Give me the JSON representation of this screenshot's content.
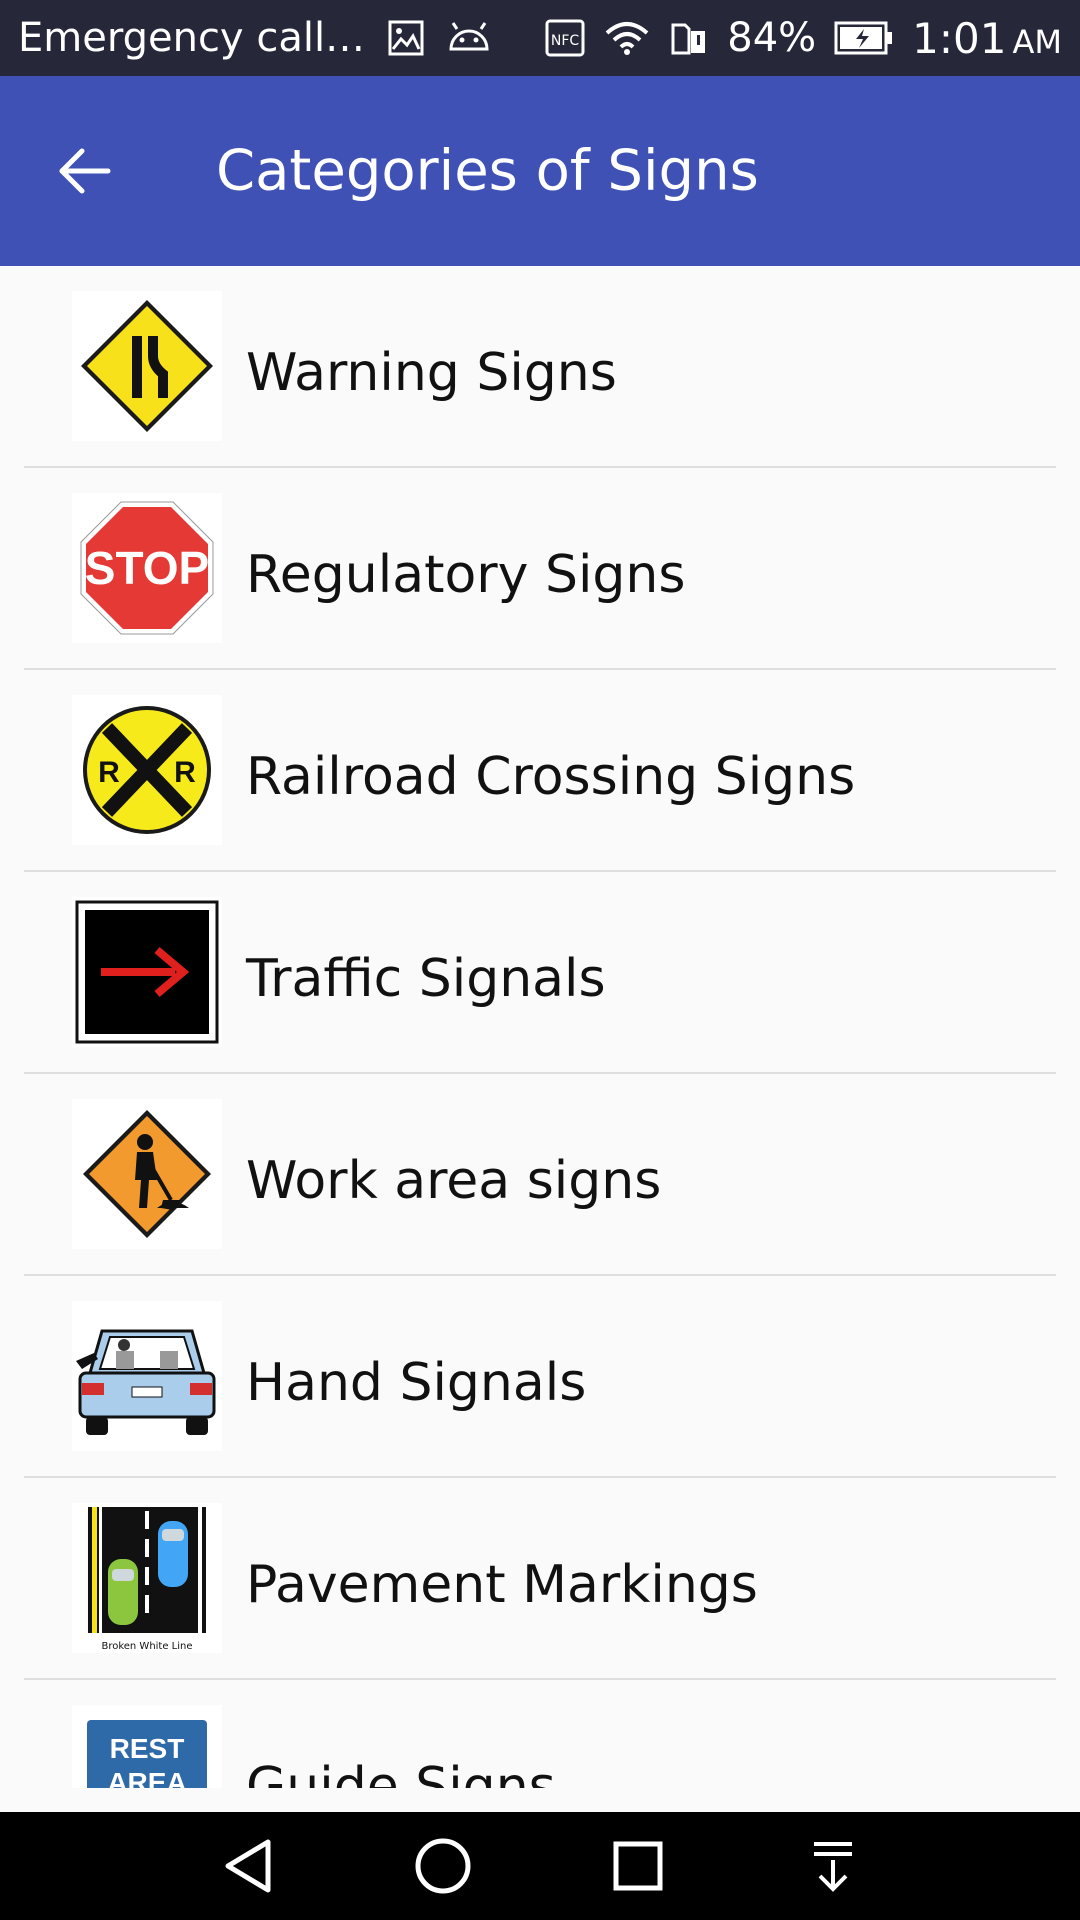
{
  "status_bar": {
    "carrier_text": "Emergency call…",
    "battery_percent": "84%",
    "time": "1:01",
    "ampm": "AM",
    "icons": [
      "gallery-icon",
      "android-icon",
      "nfc-icon",
      "wifi-icon",
      "sim-icon",
      "battery-icon"
    ]
  },
  "app_bar": {
    "title": "Categories of Signs",
    "back_icon": "arrow-back-icon",
    "color": "#3f51b5"
  },
  "list": {
    "items": [
      {
        "label": "Warning Signs",
        "icon": "warning-sign-icon"
      },
      {
        "label": "Regulatory Signs",
        "icon": "stop-sign-icon"
      },
      {
        "label": "Railroad Crossing Signs",
        "icon": "railroad-crossing-icon"
      },
      {
        "label": "Traffic Signals",
        "icon": "traffic-arrow-signal-icon"
      },
      {
        "label": "Work area signs",
        "icon": "work-area-sign-icon"
      },
      {
        "label": "Hand Signals",
        "icon": "car-hand-signal-icon"
      },
      {
        "label": "Pavement Markings",
        "icon": "pavement-markings-icon",
        "caption": "Broken White Line"
      },
      {
        "label": "Guide Signs",
        "icon": "rest-area-sign-icon",
        "sign_text": [
          "REST",
          "AREA"
        ]
      }
    ]
  },
  "nav_bar": {
    "buttons": [
      "back-triangle-icon",
      "home-circle-icon",
      "recents-square-icon",
      "notification-pull-icon"
    ]
  },
  "colors": {
    "status_bar": "#26283a",
    "app_bar": "#3f51b5",
    "background": "#fafafa",
    "divider": "#dedede",
    "warning_yellow": "#f7e11b",
    "stop_red": "#e53935",
    "work_orange": "#f29a2e",
    "guide_blue": "#2f6aa8"
  }
}
